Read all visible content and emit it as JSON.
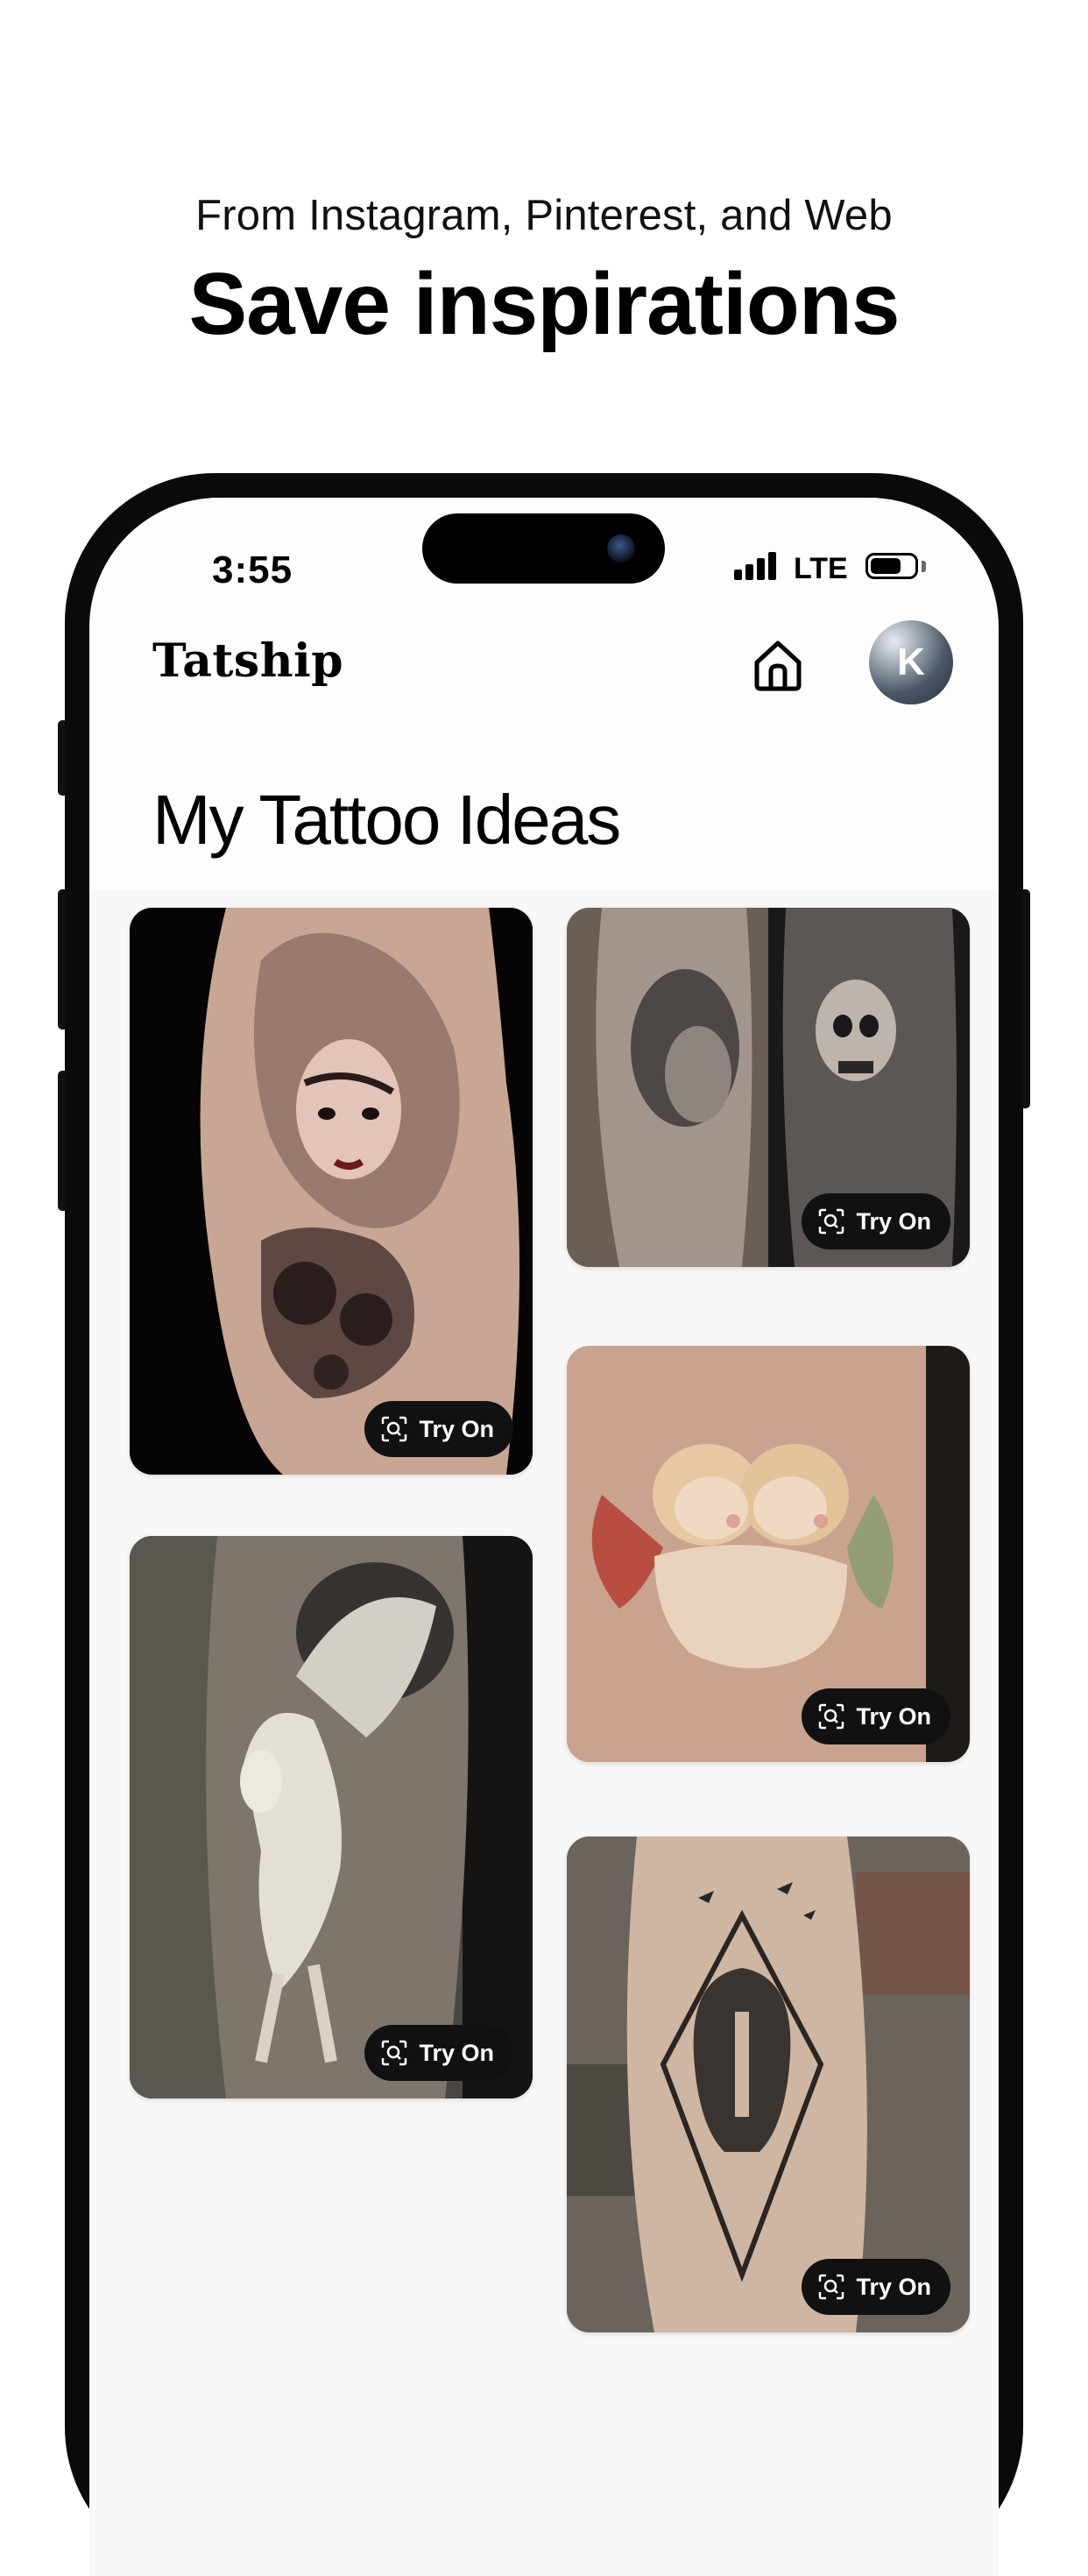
{
  "promo": {
    "subtitle": "From Instagram, Pinterest, and Web",
    "title": "Save inspirations"
  },
  "status_bar": {
    "time": "3:55",
    "network": "LTE",
    "signal_bars": 4,
    "battery_level": 0.7
  },
  "app": {
    "name": "Tatship",
    "home_icon": "home-icon",
    "avatar_initial": "K"
  },
  "page": {
    "title": "My Tattoo Ideas"
  },
  "cards": [
    {
      "subject": "woman-portrait-tattoo",
      "try_on_label": "Try On",
      "try_on_icon": "scan-face-icon"
    },
    {
      "subject": "warrior-and-skull-tattoo",
      "try_on_label": "Try On",
      "try_on_icon": "scan-face-icon"
    },
    {
      "subject": "cherubs-tattoo",
      "try_on_label": "Try On",
      "try_on_icon": "scan-face-icon"
    },
    {
      "subject": "pegasus-tattoo",
      "try_on_label": "Try On",
      "try_on_icon": "scan-face-icon"
    },
    {
      "subject": "spartan-helmet-tattoo",
      "try_on_label": "Try On",
      "try_on_icon": "scan-face-icon"
    }
  ],
  "colors": {
    "background": "#ffffff",
    "phone_frame": "#0a0a0a",
    "try_on_bg": "#111111",
    "try_on_text": "#ffffff"
  }
}
